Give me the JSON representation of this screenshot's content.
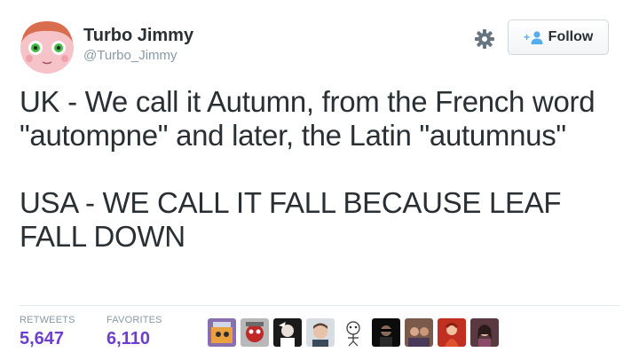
{
  "user": {
    "display_name": "Turbo Jimmy",
    "handle": "@Turbo_Jimmy",
    "avatar_icon": "cartoon-face-avatar"
  },
  "actions": {
    "settings_icon": "gear-icon",
    "follow_label": "Follow",
    "follow_icon": "add-user-icon"
  },
  "tweet": {
    "paragraph1": "UK - We call it Autumn, from the French word \"autompne\" and later, the Latin \"autumnus\"",
    "paragraph2": "USA - WE CALL IT FALL BECAUSE LEAF FALL DOWN"
  },
  "stats": {
    "retweets_label": "RETWEETS",
    "retweets_value": "5,647",
    "favorites_label": "FAVORITES",
    "favorites_value": "6,110"
  },
  "colors": {
    "stat_value": "#6d3fd0",
    "muted_text": "#8899a6",
    "follow_icon": "#55acee"
  }
}
